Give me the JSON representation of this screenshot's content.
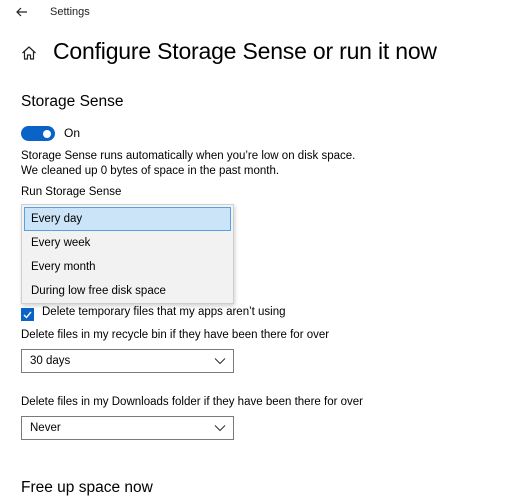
{
  "window": {
    "title": "Settings"
  },
  "page": {
    "title": "Configure Storage Sense or run it now"
  },
  "storage_sense": {
    "title": "Storage Sense",
    "toggle_state": "On",
    "description_line1": "Storage Sense runs automatically when you’re low on disk space.",
    "description_line2": "We cleaned up 0 bytes of space in the past month."
  },
  "run_storage_sense": {
    "label": "Run Storage Sense",
    "options": [
      "Every day",
      "Every week",
      "Every month",
      "During low free disk space"
    ],
    "selected_index": 0
  },
  "temp_files": {
    "label": "Delete temporary files that my apps aren’t using",
    "checked": true
  },
  "recycle_bin": {
    "label": "Delete files in my recycle bin if they have been there for over",
    "value": "30 days"
  },
  "downloads": {
    "label": "Delete files in my Downloads folder if they have been there for over",
    "value": "Never"
  },
  "free_up": {
    "title": "Free up space now"
  },
  "colors": {
    "accent": "#0a64c8",
    "selected_option_bg": "#cce4f7",
    "dropdown_bg": "#f2f2f2"
  },
  "icons": {
    "back": "back-arrow-icon",
    "home": "home-icon",
    "check": "checkmark-icon",
    "chevron": "chevron-down-icon"
  }
}
